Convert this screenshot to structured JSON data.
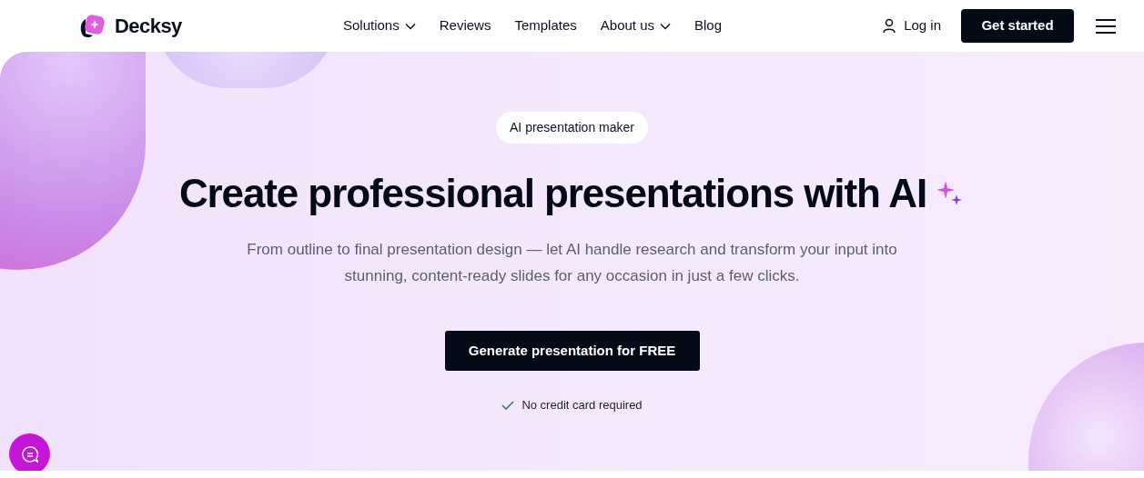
{
  "header": {
    "logo": "Decksy",
    "nav": [
      {
        "label": "Solutions",
        "dropdown": true
      },
      {
        "label": "Reviews",
        "dropdown": false
      },
      {
        "label": "Templates",
        "dropdown": false
      },
      {
        "label": "About us",
        "dropdown": true
      },
      {
        "label": "Blog",
        "dropdown": false
      }
    ],
    "login": "Log in",
    "cta": "Get started"
  },
  "hero": {
    "badge": "AI presentation maker",
    "title": "Create professional presentations with AI",
    "subtitle": "From outline to final presentation design — let AI handle research and transform your input into stunning, content-ready slides for any occasion in just a few clicks.",
    "button": "Generate presentation for FREE",
    "note": "No credit card required"
  }
}
